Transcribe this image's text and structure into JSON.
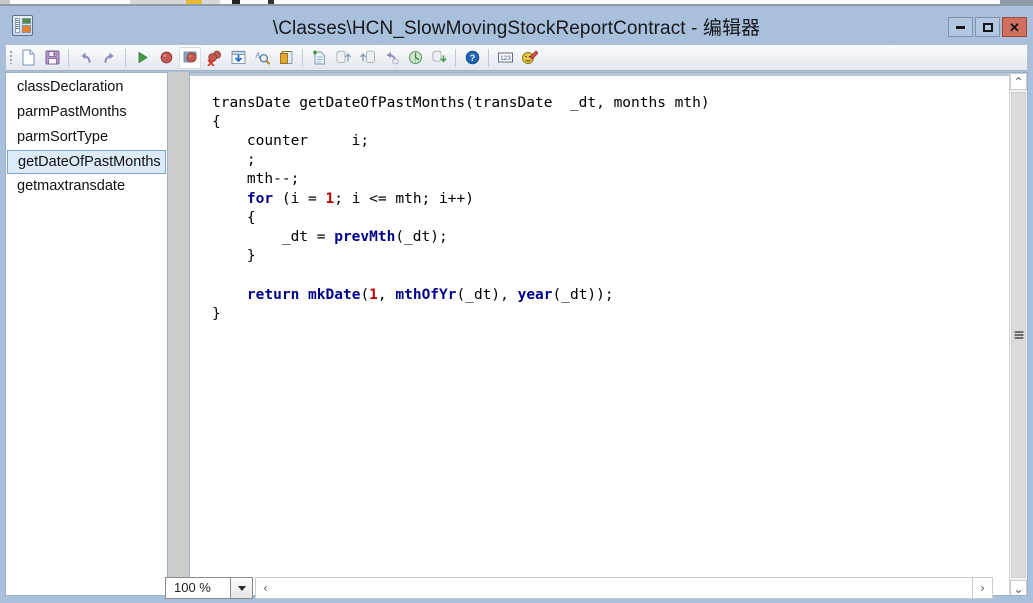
{
  "window": {
    "title": "\\Classes\\HCN_SlowMovingStockReportContract - 编辑器",
    "app_icon_name": "editor-app-icon",
    "controls": {
      "minimize": "—",
      "maximize": "□",
      "close": "✕"
    }
  },
  "toolbar": {
    "buttons": [
      {
        "name": "new-icon",
        "tooltip": "New"
      },
      {
        "name": "save-icon",
        "tooltip": "Save"
      },
      {
        "name": "undo-icon",
        "tooltip": "Undo"
      },
      {
        "name": "redo-icon",
        "tooltip": "Redo"
      },
      {
        "name": "run-icon",
        "tooltip": "Go"
      },
      {
        "name": "breakpoint-icon",
        "tooltip": "Toggle Breakpoint"
      },
      {
        "name": "breakpoint-window-icon",
        "tooltip": "Breakpoints"
      },
      {
        "name": "clear-breakpoints-icon",
        "tooltip": "Clear Breakpoints"
      },
      {
        "name": "compile-icon",
        "tooltip": "Compile"
      },
      {
        "name": "lookup-properties-icon",
        "tooltip": "Lookup Properties"
      },
      {
        "name": "properties-icon",
        "tooltip": "Properties"
      },
      {
        "name": "new-element-icon",
        "tooltip": "New Element"
      },
      {
        "name": "check-in-icon",
        "tooltip": "Check In"
      },
      {
        "name": "check-out-icon",
        "tooltip": "Check Out"
      },
      {
        "name": "undo-check-out-icon",
        "tooltip": "Undo Check Out"
      },
      {
        "name": "history-icon",
        "tooltip": "History"
      },
      {
        "name": "get-latest-icon",
        "tooltip": "Get Latest Version"
      },
      {
        "name": "help-icon",
        "tooltip": "Help"
      },
      {
        "name": "line-numbers-icon",
        "tooltip": "Line Numbers"
      },
      {
        "name": "script-editor-icon",
        "tooltip": "Editor Scripts"
      }
    ]
  },
  "tree": {
    "items": [
      {
        "label": "classDeclaration",
        "selected": false
      },
      {
        "label": "parmPastMonths",
        "selected": false
      },
      {
        "label": "parmSortType",
        "selected": false
      },
      {
        "label": "getDateOfPastMonths",
        "selected": true
      },
      {
        "label": "getmaxtransdate",
        "selected": false
      }
    ]
  },
  "editor": {
    "lines": [
      [
        {
          "t": "transDate getDateOfPastMonths(transDate  _dt, months mth)",
          "c": ""
        }
      ],
      [
        {
          "t": "{",
          "c": ""
        }
      ],
      [
        {
          "t": "    counter     i;",
          "c": ""
        }
      ],
      [
        {
          "t": "    ;",
          "c": ""
        }
      ],
      [
        {
          "t": "    mth--;",
          "c": ""
        }
      ],
      [
        {
          "t": "    ",
          "c": ""
        },
        {
          "t": "for",
          "c": "kw"
        },
        {
          "t": " (i = ",
          "c": ""
        },
        {
          "t": "1",
          "c": "num"
        },
        {
          "t": "; i <= mth; i++)",
          "c": ""
        }
      ],
      [
        {
          "t": "    {",
          "c": ""
        }
      ],
      [
        {
          "t": "        _dt = ",
          "c": ""
        },
        {
          "t": "prevMth",
          "c": "fn"
        },
        {
          "t": "(_dt);",
          "c": ""
        }
      ],
      [
        {
          "t": "    }",
          "c": ""
        }
      ],
      [
        {
          "t": "",
          "c": ""
        }
      ],
      [
        {
          "t": "    ",
          "c": ""
        },
        {
          "t": "return",
          "c": "kw"
        },
        {
          "t": " ",
          "c": ""
        },
        {
          "t": "mkDate",
          "c": "fn"
        },
        {
          "t": "(",
          "c": ""
        },
        {
          "t": "1",
          "c": "num"
        },
        {
          "t": ", ",
          "c": ""
        },
        {
          "t": "mthOfYr",
          "c": "fn"
        },
        {
          "t": "(_dt), ",
          "c": ""
        },
        {
          "t": "year",
          "c": "fn"
        },
        {
          "t": "(_dt));",
          "c": ""
        }
      ],
      [
        {
          "t": "}",
          "c": ""
        }
      ]
    ]
  },
  "statusbar": {
    "zoom_value": "100 %",
    "zoom_dropdown_name": "zoom-dropdown-arrow",
    "hscroll_left": "‹",
    "hscroll_right": "›"
  },
  "scrollbar": {
    "up_arrow": "⌃",
    "down_arrow": "⌄"
  },
  "colors": {
    "titlebar": "#a8c0dc",
    "close_button": "#d2705f",
    "selection": "#ddeaf7",
    "selection_border": "#7da2cc",
    "keyword": "#00008b",
    "number": "#c00000",
    "gutter": "#cccccc"
  }
}
